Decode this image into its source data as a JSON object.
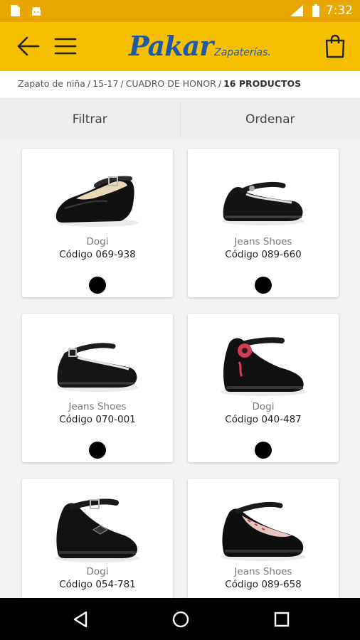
{
  "status_bar": {
    "time": "7:32"
  },
  "app_bar": {
    "logo_main": "Pakar",
    "logo_sub": "Zapaterías."
  },
  "breadcrumb": {
    "items": [
      "Zapato de niña",
      "15-17",
      "CUADRO DE HONOR"
    ],
    "count": "16 PRODUCTOS",
    "separator": "/"
  },
  "controls": {
    "filter_label": "Filtrar",
    "sort_label": "Ordenar"
  },
  "products": [
    {
      "brand": "Dogi",
      "code": "Código 069-938",
      "color": "#000000"
    },
    {
      "brand": "Jeans Shoes",
      "code": "Código 089-660",
      "color": "#000000"
    },
    {
      "brand": "Jeans Shoes",
      "code": "Código 070-001",
      "color": "#000000"
    },
    {
      "brand": "Dogi",
      "code": "Código 040-487",
      "color": "#000000"
    },
    {
      "brand": "Dogi",
      "code": "Código 054-781",
      "color": "#000000"
    },
    {
      "brand": "Jeans Shoes",
      "code": "Código 089-658",
      "color": "#000000"
    }
  ],
  "colors": {
    "app_bar": "#f6c000",
    "status_bar": "#e8a600",
    "logo": "#1e5aa6"
  }
}
